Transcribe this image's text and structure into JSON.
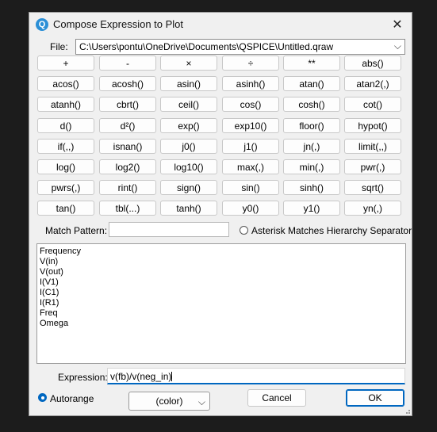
{
  "dialog": {
    "title": "Compose Expression to Plot",
    "app_icon_glyph": "Q",
    "close_glyph": "✕"
  },
  "file": {
    "label": "File:",
    "value": "C:\\Users\\pontu\\OneDrive\\Documents\\QSPICE\\Untitled.qraw",
    "arrow": "⌵"
  },
  "function_buttons": [
    [
      "+",
      "-",
      "×",
      "÷",
      "**",
      "abs()"
    ],
    [
      "acos()",
      "acosh()",
      "asin()",
      "asinh()",
      "atan()",
      "atan2(,)"
    ],
    [
      "atanh()",
      "cbrt()",
      "ceil()",
      "cos()",
      "cosh()",
      "cot()"
    ],
    [
      "d()",
      "d²()",
      "exp()",
      "exp10()",
      "floor()",
      "hypot()"
    ],
    [
      "if(,,)",
      "isnan()",
      "j0()",
      "j1()",
      "jn(,)",
      "limit(,,)"
    ],
    [
      "log()",
      "log2()",
      "log10()",
      "max(,)",
      "min(,)",
      "pwr(,)"
    ],
    [
      "pwrs(,)",
      "rint()",
      "sign()",
      "sin()",
      "sinh()",
      "sqrt()"
    ],
    [
      "tan()",
      "tbl(...)",
      "tanh()",
      "y0()",
      "y1()",
      "yn(,)"
    ]
  ],
  "match_pattern": {
    "label": "Match Pattern:",
    "value": ""
  },
  "asterisk_option": {
    "label": "Asterisk Matches Hierarchy Separator",
    "checked": false
  },
  "traces": [
    "Frequency",
    "V(in)",
    "V(out)",
    "I(V1)",
    "I(C1)",
    "I(R1)",
    "Freq",
    "Omega"
  ],
  "expression": {
    "label": "Expression:",
    "value": "v(fb)/v(neg_in)"
  },
  "autorange": {
    "label": "Autorange",
    "checked": true
  },
  "color_select": {
    "value": "(color)",
    "arrow": "⌵"
  },
  "buttons": {
    "cancel": "Cancel",
    "ok": "OK"
  },
  "colors": {
    "accent": "#0067c0",
    "dialog_bg": "#f0f0f0",
    "app_icon": "#2b8fd6"
  }
}
